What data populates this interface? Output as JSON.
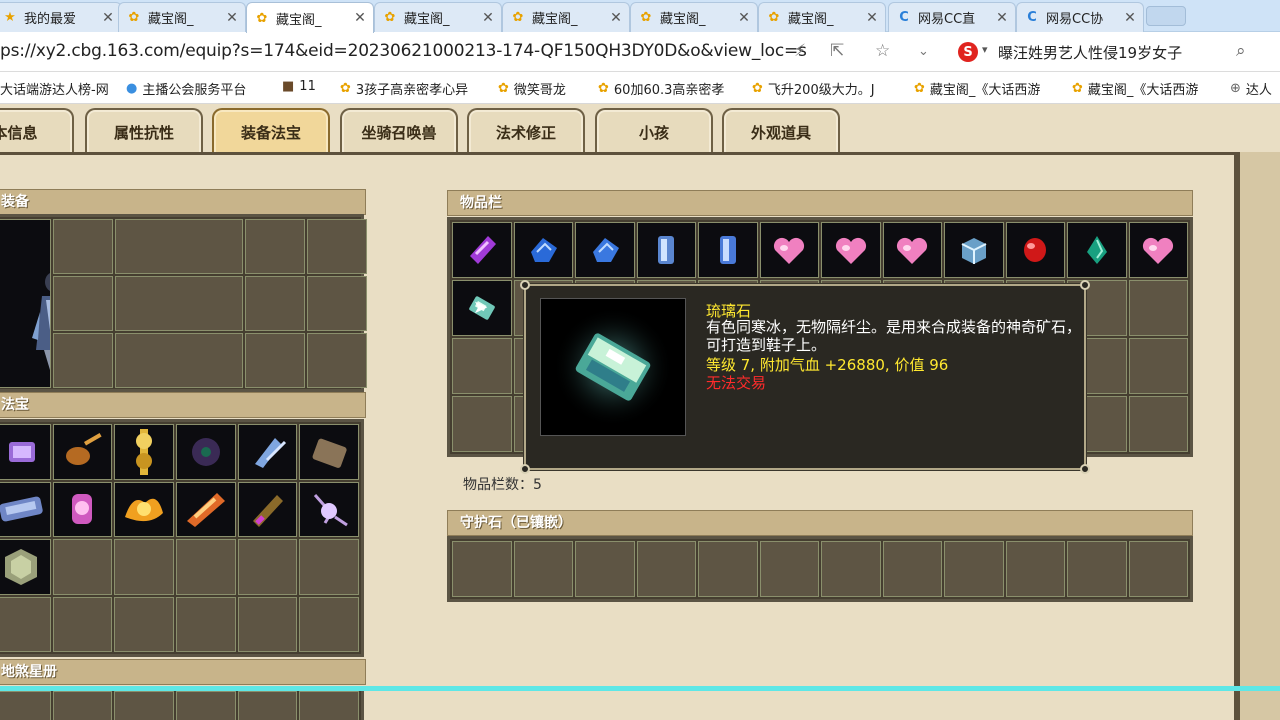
{
  "browser": {
    "tabs": [
      {
        "title": "我的最爱",
        "icon": "star-icon",
        "active": false
      },
      {
        "title": "藏宝阁_",
        "icon": "chick-icon",
        "active": false
      },
      {
        "title": "藏宝阁_",
        "icon": "chick-icon",
        "active": true
      },
      {
        "title": "藏宝阁_",
        "icon": "chick-icon",
        "active": false
      },
      {
        "title": "藏宝阁_",
        "icon": "chick-icon",
        "active": false
      },
      {
        "title": "藏宝阁_",
        "icon": "chick-icon",
        "active": false
      },
      {
        "title": "藏宝阁_",
        "icon": "chick-icon",
        "active": false
      },
      {
        "title": "网易CC直",
        "icon": "cc-icon",
        "active": false
      },
      {
        "title": "网易CC协",
        "icon": "cc-icon",
        "active": false
      }
    ],
    "url": "ps://xy2.cbg.163.com/equip?s=174&eid=20230621000213-174-QF150QH3DY0D&o&view_loc=s",
    "search_text": "曝汪姓男艺人性侵19岁女子",
    "bookmarks": [
      "大话端游达人榜-网",
      "主播公会服务平台",
      "11",
      "3孩子高亲密孝心异",
      "微笑哥龙",
      "60加60.3高亲密孝",
      "飞升200级大力。J",
      "藏宝阁_《大话西游",
      "藏宝阁_《大话西游",
      "达人"
    ]
  },
  "nav_tabs": [
    "本信息",
    "属性抗性",
    "装备法宝",
    "坐骑召唤兽",
    "法术修正",
    "小孩",
    "外观道具"
  ],
  "active_nav_tab": "装备法宝",
  "sections": {
    "equipment": "装备",
    "treasure": "法宝",
    "star_book": "地煞星册",
    "inventory": "物品栏",
    "guard_stone": "守护石（已镶嵌）"
  },
  "inventory_count_label": "物品栏数：5",
  "tooltip": {
    "name": "琉璃石",
    "description": "有色同寒冰，无物隔纤尘。是用来合成装备的神奇矿石，可打造到鞋子上。",
    "stats": "等级 7, 附加气血 +26880, 价值 96",
    "trade": "无法交易"
  },
  "colors": {
    "accent_yellow": "#ffe830",
    "warning_red": "#ff2b2b",
    "panel_title": "#c8b48a",
    "page_bg": "#e9dec4"
  }
}
